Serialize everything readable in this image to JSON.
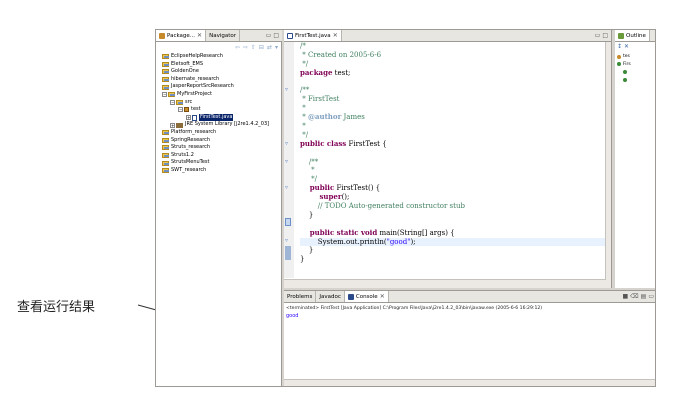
{
  "annotation": {
    "text": "查看运行结果"
  },
  "package_explorer": {
    "tabs": [
      {
        "label": "Package...",
        "active": true
      },
      {
        "label": "Navigator",
        "active": false
      }
    ],
    "tree": [
      {
        "label": "EclipseHelpResearch",
        "depth": 0,
        "icon": "project-folder-icon"
      },
      {
        "label": "Eletsoft_EMS",
        "depth": 0,
        "icon": "project-folder-icon"
      },
      {
        "label": "GoldenOne",
        "depth": 0,
        "icon": "project-folder-icon"
      },
      {
        "label": "hibernate_research",
        "depth": 0,
        "icon": "project-folder-icon"
      },
      {
        "label": "JasperReportSrcResearch",
        "depth": 0,
        "icon": "project-folder-icon"
      },
      {
        "label": "MyFirstProject",
        "depth": 0,
        "icon": "project-folder-icon",
        "expander": "−"
      },
      {
        "label": "src",
        "depth": 1,
        "icon": "source-folder-icon",
        "expander": "−"
      },
      {
        "label": "test",
        "depth": 2,
        "icon": "package-icon",
        "expander": "−"
      },
      {
        "label": "FirstTest.java",
        "depth": 3,
        "icon": "java-file-icon",
        "expander": "+",
        "selected": true
      },
      {
        "label": "JRE System Library [j2re1.4.2_03]",
        "depth": 1,
        "icon": "jre-library-icon",
        "expander": "+"
      },
      {
        "label": "Platform_research",
        "depth": 0,
        "icon": "project-folder-icon"
      },
      {
        "label": "SpringResearch",
        "depth": 0,
        "icon": "project-folder-icon"
      },
      {
        "label": "Struts_research",
        "depth": 0,
        "icon": "project-folder-icon"
      },
      {
        "label": "Struts1.2",
        "depth": 0,
        "icon": "project-folder-icon"
      },
      {
        "label": "StrutsMenuTest",
        "depth": 0,
        "icon": "project-folder-icon"
      },
      {
        "label": "SWT_research",
        "depth": 0,
        "icon": "project-folder-icon"
      }
    ]
  },
  "editor": {
    "tab_label": "FirstTest.java",
    "lines": [
      [
        {
          "t": "/*",
          "c": "cmt"
        }
      ],
      [
        {
          "t": " * Created on 2005-6-6",
          "c": "cmt"
        }
      ],
      [
        {
          "t": " */",
          "c": "cmt"
        }
      ],
      [
        {
          "t": "package",
          "c": "kw"
        },
        {
          "t": " test;",
          "c": ""
        }
      ],
      [
        {
          "t": "",
          "c": ""
        }
      ],
      [
        {
          "t": "/**",
          "c": "cmt"
        }
      ],
      [
        {
          "t": " * FirstTest",
          "c": "cmt"
        }
      ],
      [
        {
          "t": " *",
          "c": "cmt"
        }
      ],
      [
        {
          "t": " * ",
          "c": "cmt"
        },
        {
          "t": "@author",
          "c": "tag"
        },
        {
          "t": " James",
          "c": "cmt"
        }
      ],
      [
        {
          "t": " *",
          "c": "cmt"
        }
      ],
      [
        {
          "t": " */",
          "c": "cmt"
        }
      ],
      [
        {
          "t": "public class",
          "c": "kw"
        },
        {
          "t": " FirstTest {",
          "c": ""
        }
      ],
      [
        {
          "t": "",
          "c": ""
        }
      ],
      [
        {
          "t": "    /**",
          "c": "cmt"
        }
      ],
      [
        {
          "t": "     *",
          "c": "cmt"
        }
      ],
      [
        {
          "t": "     */",
          "c": "cmt"
        }
      ],
      [
        {
          "t": "    public",
          "c": "kw"
        },
        {
          "t": " FirstTest() {",
          "c": ""
        }
      ],
      [
        {
          "t": "        super",
          "c": "kw"
        },
        {
          "t": "();",
          "c": ""
        }
      ],
      [
        {
          "t": "        // TODO Auto-generated constructor stub",
          "c": "cmt"
        }
      ],
      [
        {
          "t": "    }",
          "c": ""
        }
      ],
      [
        {
          "t": "",
          "c": ""
        }
      ],
      [
        {
          "t": "    public static void",
          "c": "kw"
        },
        {
          "t": " main(String[] args) {",
          "c": ""
        }
      ],
      [
        {
          "t": "        System.out.println(",
          "c": ""
        },
        {
          "t": "\"good\"",
          "c": "str"
        },
        {
          "t": ");",
          "c": ""
        }
      ],
      [
        {
          "t": "    }",
          "c": ""
        }
      ],
      [
        {
          "t": "}",
          "c": ""
        }
      ]
    ]
  },
  "outline": {
    "tab_label": "Outline",
    "items": [
      {
        "label": "tes",
        "depth": 0
      },
      {
        "label": "Firs",
        "depth": 0
      },
      {
        "label": "",
        "depth": 1
      },
      {
        "label": "",
        "depth": 1
      }
    ]
  },
  "console": {
    "tabs": [
      {
        "label": "Problems",
        "active": false
      },
      {
        "label": "Javadoc",
        "active": false
      },
      {
        "label": "Console",
        "active": true
      }
    ],
    "status": "<terminated> FirstTest [Java Application] C:\\Program Files\\Java\\j2re1.4.2_03\\bin\\javaw.exe (2005-6-6 16:29:12)",
    "output": "good"
  }
}
